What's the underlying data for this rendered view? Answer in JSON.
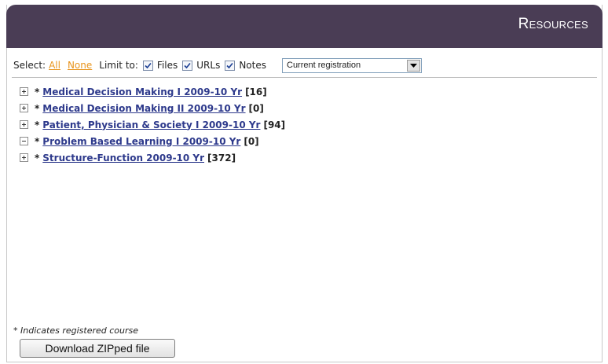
{
  "header": {
    "title": "Resources"
  },
  "toolbar": {
    "select_label": "Select:",
    "all_link": "All",
    "none_link": "None",
    "limit_label": "Limit to:",
    "filters": [
      {
        "label": "Files",
        "checked": true
      },
      {
        "label": "URLs",
        "checked": true
      },
      {
        "label": "Notes",
        "checked": true
      }
    ],
    "dropdown": {
      "selected": "Current registration"
    }
  },
  "courses": [
    {
      "toggle": "+",
      "marker": "*",
      "title": "Medical Decision Making I 2009-10 Yr",
      "count": "[16]"
    },
    {
      "toggle": "+",
      "marker": "*",
      "title": "Medical Decision Making II 2009-10 Yr",
      "count": "[0]"
    },
    {
      "toggle": "+",
      "marker": "*",
      "title": "Patient, Physician & Society I 2009-10 Yr",
      "count": "[94]"
    },
    {
      "toggle": "-",
      "marker": "*",
      "title": "Problem Based Learning I 2009-10 Yr",
      "count": "[0]"
    },
    {
      "toggle": "+",
      "marker": "*",
      "title": "Structure-Function 2009-10 Yr",
      "count": "[372]"
    }
  ],
  "footer": {
    "note": "* Indicates registered course",
    "download_label": "Download ZIPped file"
  },
  "colors": {
    "header_bg": "#4a3d55",
    "link": "#2e3a8c",
    "select_link": "#e8951e"
  }
}
